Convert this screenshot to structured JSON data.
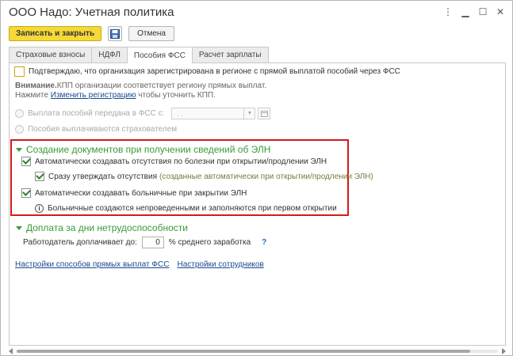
{
  "window": {
    "title": "ООО Надо: Учетная политика",
    "icons": [
      "more-icon",
      "minimize-icon",
      "maximize-icon",
      "close-icon"
    ]
  },
  "toolbar": {
    "save_close_label": "Записать и закрыть",
    "cancel_label": "Отмена"
  },
  "tabs": [
    {
      "label": "Страховые взносы",
      "active": false
    },
    {
      "label": "НДФЛ",
      "active": false
    },
    {
      "label": "Пособия ФСС",
      "active": true
    },
    {
      "label": "Расчет зарплаты",
      "active": false
    }
  ],
  "fss": {
    "confirm_label": "Подтверждаю, что организация зарегистрирована в регионе с прямой выплатой пособий через ФСС",
    "attention_bold": "Внимание.",
    "attention_text": " КПП организации соответствует региону прямых выплат.",
    "press_text": "Нажмите ",
    "change_link": "Изменить регистрацию",
    "after_link": " чтобы уточнить КПП.",
    "radio_transferred": "Выплата пособий передана в ФСС с:",
    "date_placeholder": ". .",
    "radio_employer": "Пособия выплачиваются страхователем"
  },
  "eln": {
    "section_title": "Создание документов при получении сведений об ЭЛН",
    "auto_absence": "Автоматически создавать отсутствия по болезни при открытии/продлении ЭЛН",
    "approve_absence": "Сразу утверждать отсутствия",
    "approve_note": "(созданные автоматически при открытии/продлении ЭЛН)",
    "auto_sick": "Автоматически создавать больничные при закрытии ЭЛН",
    "info_text": "Больничные создаются непроведенными и заполняются при первом открытии"
  },
  "extra": {
    "section_title": "Доплата за дни нетрудоспособности",
    "employer_pays": "Работодатель доплачивает до:",
    "value": "0",
    "suffix": "% среднего заработка",
    "help": "?"
  },
  "links": {
    "fss_settings": "Настройки способов прямых выплат ФСС",
    "staff_settings": "Настройки сотрудников"
  }
}
